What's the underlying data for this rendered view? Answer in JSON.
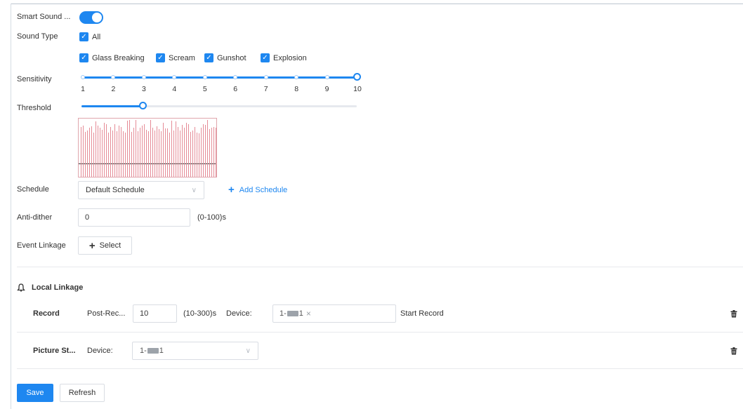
{
  "smart_sound": {
    "label": "Smart Sound ...",
    "enabled": true
  },
  "sound_type": {
    "label": "Sound Type",
    "all_label": "All",
    "options": [
      {
        "label": "Glass Breaking",
        "checked": true
      },
      {
        "label": "Scream",
        "checked": true
      },
      {
        "label": "Gunshot",
        "checked": true
      },
      {
        "label": "Explosion",
        "checked": true
      }
    ]
  },
  "sensitivity": {
    "label": "Sensitivity",
    "value": 10,
    "ticks": [
      "1",
      "2",
      "3",
      "4",
      "5",
      "6",
      "7",
      "8",
      "9",
      "10"
    ]
  },
  "threshold": {
    "label": "Threshold",
    "value_fraction": 0.23
  },
  "schedule": {
    "label": "Schedule",
    "value": "Default Schedule",
    "add_label": "Add Schedule"
  },
  "anti_dither": {
    "label": "Anti-dither",
    "value": "0",
    "range": "(0-100)s"
  },
  "event_linkage": {
    "label": "Event Linkage",
    "select_label": "Select"
  },
  "local_linkage": {
    "title": "Local Linkage",
    "record": {
      "title": "Record",
      "post_label": "Post-Rec...",
      "post_value": "10",
      "post_range": "(10-300)s",
      "device_label": "Device:",
      "device_tag_prefix": "1-",
      "device_tag_suffix": "1",
      "action": "Start Record"
    },
    "picture": {
      "title": "Picture St...",
      "device_label": "Device:",
      "device_prefix": "1-",
      "device_suffix": "1"
    }
  },
  "footer": {
    "save_label": "Save",
    "refresh_label": "Refresh"
  },
  "colors": {
    "accent": "#1e87f0",
    "wave": "#e58b96"
  },
  "icons": {
    "toggle": "toggle-switch",
    "check": "checkmark-icon",
    "linkage": "bell-icon",
    "delete": "trash-icon",
    "add": "plus-icon",
    "dropdown": "chevron-down-icon"
  }
}
